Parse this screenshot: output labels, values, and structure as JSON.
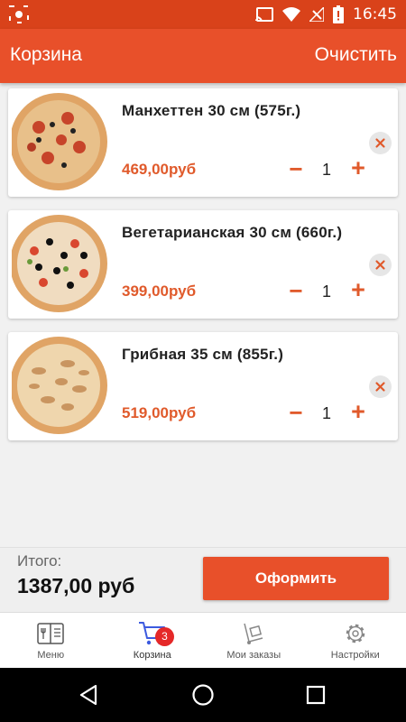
{
  "status_bar": {
    "time": "16:45"
  },
  "app_bar": {
    "title": "Корзина",
    "clear_label": "Очистить"
  },
  "cart": {
    "items": [
      {
        "name": "Манхеттен 30 см (575г.)",
        "price": "469,00руб",
        "quantity": "1"
      },
      {
        "name": "Вегетарианская 30 см (660г.)",
        "price": "399,00руб",
        "quantity": "1"
      },
      {
        "name": "Грибная 35 см (855г.)",
        "price": "519,00руб",
        "quantity": "1"
      }
    ],
    "minus_glyph": "−",
    "plus_glyph": "+"
  },
  "total": {
    "label": "Итого:",
    "value": "1387,00 руб"
  },
  "checkout_label": "Оформить",
  "bottom_nav": {
    "items": [
      {
        "label": "Меню",
        "icon": "menu-book-icon"
      },
      {
        "label": "Корзина",
        "icon": "cart-icon"
      },
      {
        "label": "Мои заказы",
        "icon": "delivery-cart-icon"
      },
      {
        "label": "Настройки",
        "icon": "gear-icon"
      }
    ],
    "cart_badge": "3"
  },
  "colors": {
    "status_bar": "#d9421a",
    "app_bar": "#e8502a",
    "accent": "#e05a2b",
    "badge": "#e52828",
    "active_nav": "#3c5adf"
  }
}
